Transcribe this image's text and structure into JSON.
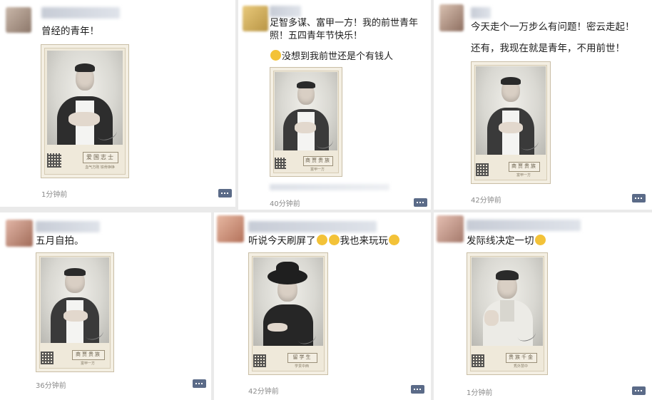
{
  "posts": [
    {
      "text_lines": [
        "曾经的青年！"
      ],
      "photo": {
        "stamp": "爱国志士",
        "stamp_sub": "血气方刚 铁骨铮铮",
        "subject": "man-robe"
      },
      "time": "1分钟前"
    },
    {
      "text_lines": [
        "足智多谋、富甲一方！我的前世青年",
        "照！五四青年节快乐！"
      ],
      "text_line_extra": "没想到我前世还是个有钱人",
      "photo": {
        "stamp": "商贾贵族",
        "stamp_sub": "富甲一方",
        "subject": "man-vest"
      },
      "time": "40分钟前"
    },
    {
      "text_lines": [
        "今天走个一万步么有问题！密云走起！"
      ],
      "text_line_extra": "还有，我现在就是青年，不用前世！",
      "photo": {
        "stamp": "商贾贵族",
        "stamp_sub": "富甲一方",
        "subject": "man-vest"
      },
      "time": "42分钟前"
    },
    {
      "text_lines": [
        "五月自拍。"
      ],
      "photo": {
        "stamp": "商贾贵族",
        "stamp_sub": "富甲一方",
        "subject": "man-vest"
      },
      "time": "36分钟前"
    },
    {
      "text_lines": [
        "听说今天刷屏了",
        "我也来玩玩"
      ],
      "photo": {
        "stamp": "留学生",
        "stamp_sub": "学贯中西",
        "subject": "woman-hat"
      },
      "time": "42分钟前"
    },
    {
      "text_lines": [
        "发际线决定一切"
      ],
      "photo": {
        "stamp": "贵族千金",
        "stamp_sub": "秀外慧中",
        "subject": "woman-blouse"
      },
      "time": "1分钟前"
    }
  ],
  "icons": {
    "comment": "comment-icon",
    "emoji": "emoji-icon",
    "avatar": "avatar"
  },
  "colors": {
    "background": "#eaeaea",
    "card_bg": "#ffffff",
    "time_text": "#8a8a8a",
    "comment_button": "#5b6b88",
    "photo_frame": "#efe9da"
  }
}
